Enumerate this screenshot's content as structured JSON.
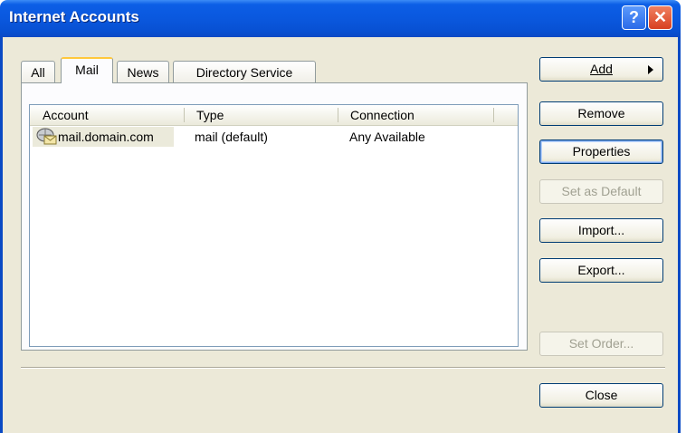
{
  "window": {
    "title": "Internet Accounts",
    "help_glyph": "?",
    "close_glyph": "✕"
  },
  "tabs": [
    {
      "label": "All"
    },
    {
      "label": "Mail",
      "selected": true
    },
    {
      "label": "News"
    },
    {
      "label": "Directory Service"
    }
  ],
  "list": {
    "columns": [
      "Account",
      "Type",
      "Connection"
    ],
    "rows": [
      {
        "account": "mail.domain.com",
        "type": "mail (default)",
        "connection": "Any Available",
        "icon": "mail-account-icon"
      }
    ]
  },
  "buttons": {
    "add": "Add",
    "remove": "Remove",
    "properties": "Properties",
    "set_default": "Set as Default",
    "import": "Import...",
    "export": "Export...",
    "set_order": "Set Order...",
    "close": "Close"
  },
  "colors": {
    "titlebar": "#0a58de",
    "face": "#ece9d8",
    "tab_highlight": "#ffc83c"
  }
}
